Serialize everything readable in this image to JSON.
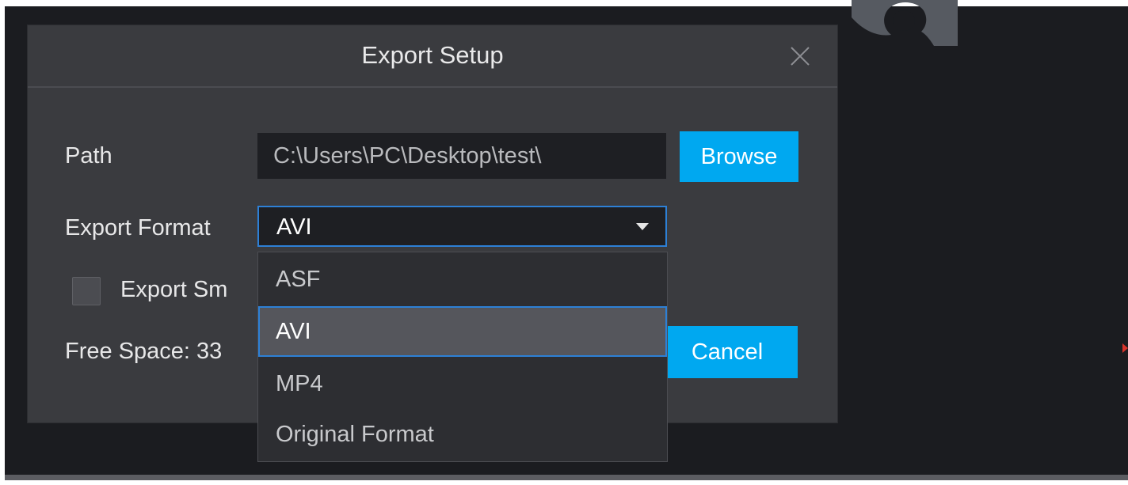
{
  "dialog": {
    "title": "Export Setup",
    "path_label": "Path",
    "path_value": "C:\\Users\\PC\\Desktop\\test\\",
    "browse_label": "Browse",
    "format_label": "Export Format",
    "format_value": "AVI",
    "export_small_label": "Export Sm",
    "free_space_label": "Free Space: 33",
    "cancel_label": "Cancel"
  },
  "dropdown": {
    "options": [
      "ASF",
      "AVI",
      "MP4",
      "Original Format"
    ],
    "selected": "AVI"
  },
  "icons": {
    "close": "close-icon",
    "dropdown_arrow": "chevron-down-icon",
    "background_logo": "app-logo-icon"
  },
  "colors": {
    "accent": "#00a8f0",
    "focus_border": "#2d80d6",
    "dialog_bg": "#3a3b3f",
    "input_bg": "#1e1f23"
  }
}
